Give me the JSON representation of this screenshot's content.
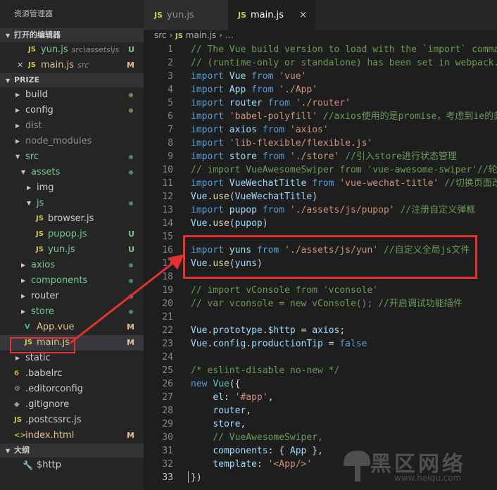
{
  "sidebar": {
    "title": "资源管理器",
    "open_editors": {
      "title": "打开的编辑器",
      "items": [
        {
          "icon": "JS",
          "name": "yun.js",
          "path": "src\\assets\\js",
          "status": "U"
        },
        {
          "icon": "JS",
          "name": "main.js",
          "path": "src",
          "status": "M"
        }
      ]
    },
    "project": {
      "title": "PRIZE",
      "tree": [
        {
          "name": "build",
          "level": 0,
          "type": "folder",
          "expanded": false,
          "status": "dot-mod"
        },
        {
          "name": "config",
          "level": 0,
          "type": "folder",
          "expanded": false,
          "status": "dot-mod"
        },
        {
          "name": "dist",
          "level": 0,
          "type": "folder",
          "expanded": false,
          "status": "ignored"
        },
        {
          "name": "node_modules",
          "level": 0,
          "type": "folder",
          "expanded": false,
          "status": "ignored"
        },
        {
          "name": "src",
          "level": 0,
          "type": "folder",
          "expanded": true,
          "status": "dot-untracked"
        },
        {
          "name": "assets",
          "level": 1,
          "type": "folder",
          "expanded": true,
          "status": "dot-untracked"
        },
        {
          "name": "img",
          "level": 2,
          "type": "folder",
          "expanded": false,
          "status": ""
        },
        {
          "name": "js",
          "level": 2,
          "type": "folder",
          "expanded": true,
          "status": "dot-untracked"
        },
        {
          "name": "browser.js",
          "level": 3,
          "type": "file",
          "icon": "JS",
          "status": ""
        },
        {
          "name": "pupop.js",
          "level": 3,
          "type": "file",
          "icon": "JS",
          "status": "U"
        },
        {
          "name": "yun.js",
          "level": 3,
          "type": "file",
          "icon": "JS",
          "status": "U"
        },
        {
          "name": "axios",
          "level": 1,
          "type": "folder",
          "expanded": false,
          "status": "dot-untracked"
        },
        {
          "name": "components",
          "level": 1,
          "type": "folder",
          "expanded": false,
          "status": "dot-untracked"
        },
        {
          "name": "router",
          "level": 1,
          "type": "folder",
          "expanded": false,
          "status": "dot-mod"
        },
        {
          "name": "store",
          "level": 1,
          "type": "folder",
          "expanded": false,
          "status": "dot-untracked"
        },
        {
          "name": "App.vue",
          "level": 1,
          "type": "file",
          "icon": "V",
          "status": "M"
        },
        {
          "name": "main.js",
          "level": 1,
          "type": "file",
          "icon": "JS",
          "status": "M",
          "selected": true
        },
        {
          "name": "static",
          "level": 0,
          "type": "folder",
          "expanded": false,
          "status": ""
        },
        {
          "name": ".babelrc",
          "level": 0,
          "type": "file",
          "icon": "6",
          "status": ""
        },
        {
          "name": ".editorconfig",
          "level": 0,
          "type": "file",
          "icon": "⚙",
          "status": ""
        },
        {
          "name": ".gitignore",
          "level": 0,
          "type": "file",
          "icon": "◆",
          "status": ""
        },
        {
          "name": ".postcssrc.js",
          "level": 0,
          "type": "file",
          "icon": "JS",
          "status": ""
        },
        {
          "name": "index.html",
          "level": 0,
          "type": "file",
          "icon": "<>",
          "status": "M"
        }
      ]
    },
    "outline": {
      "title": "大纲",
      "items": [
        {
          "icon": "🔧",
          "name": "$http"
        }
      ]
    }
  },
  "tabs": [
    {
      "icon": "JS",
      "label": "yun.js",
      "active": false
    },
    {
      "icon": "JS",
      "label": "main.js",
      "active": true,
      "close": "×"
    }
  ],
  "breadcrumb": {
    "folder": "src",
    "sep": "›",
    "icon": "JS",
    "file": "main.js",
    "more": "…"
  },
  "editor": {
    "active_line": 33,
    "lines": [
      [
        [
          "cm",
          "// The Vue build version to load with the `import` command"
        ]
      ],
      [
        [
          "cm",
          "// (runtime-only or standalone) has been set in webpack.base.conf"
        ]
      ],
      [
        [
          "kw",
          "import "
        ],
        [
          "var",
          "Vue "
        ],
        [
          "kw",
          "from "
        ],
        [
          "str",
          "'vue'"
        ]
      ],
      [
        [
          "kw",
          "import "
        ],
        [
          "var",
          "App "
        ],
        [
          "kw",
          "from "
        ],
        [
          "str",
          "'./App'"
        ]
      ],
      [
        [
          "kw",
          "import "
        ],
        [
          "var",
          "router "
        ],
        [
          "kw",
          "from "
        ],
        [
          "str",
          "'./router'"
        ]
      ],
      [
        [
          "kw",
          "import "
        ],
        [
          "str",
          "'babel-polyfill' "
        ],
        [
          "cm",
          "//axios使用的是promise，考虑到ie的兼容性"
        ]
      ],
      [
        [
          "kw",
          "import "
        ],
        [
          "var",
          "axios "
        ],
        [
          "kw",
          "from "
        ],
        [
          "str",
          "'axios'"
        ]
      ],
      [
        [
          "kw",
          "import "
        ],
        [
          "str",
          "'lib-flexible/flexible.js'"
        ]
      ],
      [
        [
          "kw",
          "import "
        ],
        [
          "var",
          "store "
        ],
        [
          "kw",
          "from "
        ],
        [
          "str",
          "'./store' "
        ],
        [
          "cm",
          "//引入store进行状态管理"
        ]
      ],
      [
        [
          "cm",
          "// import VueAwesomeSwiper from 'vue-awesome-swiper'//轮播插件"
        ]
      ],
      [
        [
          "kw",
          "import "
        ],
        [
          "var",
          "VueWechatTitle "
        ],
        [
          "kw",
          "from "
        ],
        [
          "str",
          "'vue-wechat-title' "
        ],
        [
          "cm",
          "//切换页面改变标题"
        ]
      ],
      [
        [
          "var",
          "Vue"
        ],
        [
          "def",
          "."
        ],
        [
          "mth",
          "use"
        ],
        [
          "def",
          "("
        ],
        [
          "var",
          "VueWechatTitle"
        ],
        [
          "def",
          ")"
        ]
      ],
      [
        [
          "kw",
          "import "
        ],
        [
          "var",
          "pupop "
        ],
        [
          "kw",
          "from "
        ],
        [
          "str",
          "'./assets/js/pupop' "
        ],
        [
          "cm",
          "//注册自定义弹框"
        ]
      ],
      [
        [
          "var",
          "Vue"
        ],
        [
          "def",
          "."
        ],
        [
          "mth",
          "use"
        ],
        [
          "def",
          "("
        ],
        [
          "var",
          "pupop"
        ],
        [
          "def",
          ")"
        ]
      ],
      [],
      [
        [
          "kw",
          "import "
        ],
        [
          "var",
          "yuns "
        ],
        [
          "kw",
          "from "
        ],
        [
          "str",
          "'./assets/js/yun' "
        ],
        [
          "cm",
          "//自定义全局js文件"
        ]
      ],
      [
        [
          "var",
          "Vue"
        ],
        [
          "def",
          "."
        ],
        [
          "mth",
          "use"
        ],
        [
          "def",
          "("
        ],
        [
          "var",
          "yuns"
        ],
        [
          "def",
          ")"
        ]
      ],
      [],
      [
        [
          "cm",
          "// import vConsole from 'vconsole'"
        ]
      ],
      [
        [
          "cm",
          "// var vconsole = new vConsole(); //开启调试功能插件"
        ]
      ],
      [],
      [
        [
          "var",
          "Vue"
        ],
        [
          "def",
          "."
        ],
        [
          "var",
          "prototype"
        ],
        [
          "def",
          "."
        ],
        [
          "var",
          "$http "
        ],
        [
          "def",
          "= "
        ],
        [
          "var",
          "axios"
        ],
        [
          "def",
          ";"
        ]
      ],
      [
        [
          "var",
          "Vue"
        ],
        [
          "def",
          "."
        ],
        [
          "var",
          "config"
        ],
        [
          "def",
          "."
        ],
        [
          "var",
          "productionTip "
        ],
        [
          "def",
          "= "
        ],
        [
          "kw",
          "false"
        ]
      ],
      [],
      [
        [
          "cm",
          "/* eslint-disable no-new */"
        ]
      ],
      [
        [
          "kw",
          "new "
        ],
        [
          "cls",
          "Vue"
        ],
        [
          "def",
          "({"
        ]
      ],
      [
        [
          "def",
          "    "
        ],
        [
          "var",
          "el"
        ],
        [
          "def",
          ": "
        ],
        [
          "str",
          "'#app'"
        ],
        [
          "def",
          ","
        ]
      ],
      [
        [
          "def",
          "    "
        ],
        [
          "var",
          "router"
        ],
        [
          "def",
          ","
        ]
      ],
      [
        [
          "def",
          "    "
        ],
        [
          "var",
          "store"
        ],
        [
          "def",
          ","
        ]
      ],
      [
        [
          "def",
          "    "
        ],
        [
          "cm",
          "// VueAwesomeSwiper,"
        ]
      ],
      [
        [
          "def",
          "    "
        ],
        [
          "var",
          "components"
        ],
        [
          "def",
          ": { "
        ],
        [
          "var",
          "App "
        ],
        [
          "def",
          "},"
        ]
      ],
      [
        [
          "def",
          "    "
        ],
        [
          "var",
          "template"
        ],
        [
          "def",
          ": "
        ],
        [
          "str",
          "'<App/>'"
        ]
      ],
      [
        [
          "def",
          "})"
        ]
      ]
    ]
  },
  "watermark": {
    "text": "黑区网络",
    "url": "www.heiqu.com"
  },
  "colors": {
    "annotation": "#e5312e",
    "untracked": "#73c991",
    "modified": "#e2c08d",
    "keyword": "#569cd6",
    "string": "#ce9178",
    "comment": "#6a9955",
    "variable": "#9cdcfe"
  }
}
